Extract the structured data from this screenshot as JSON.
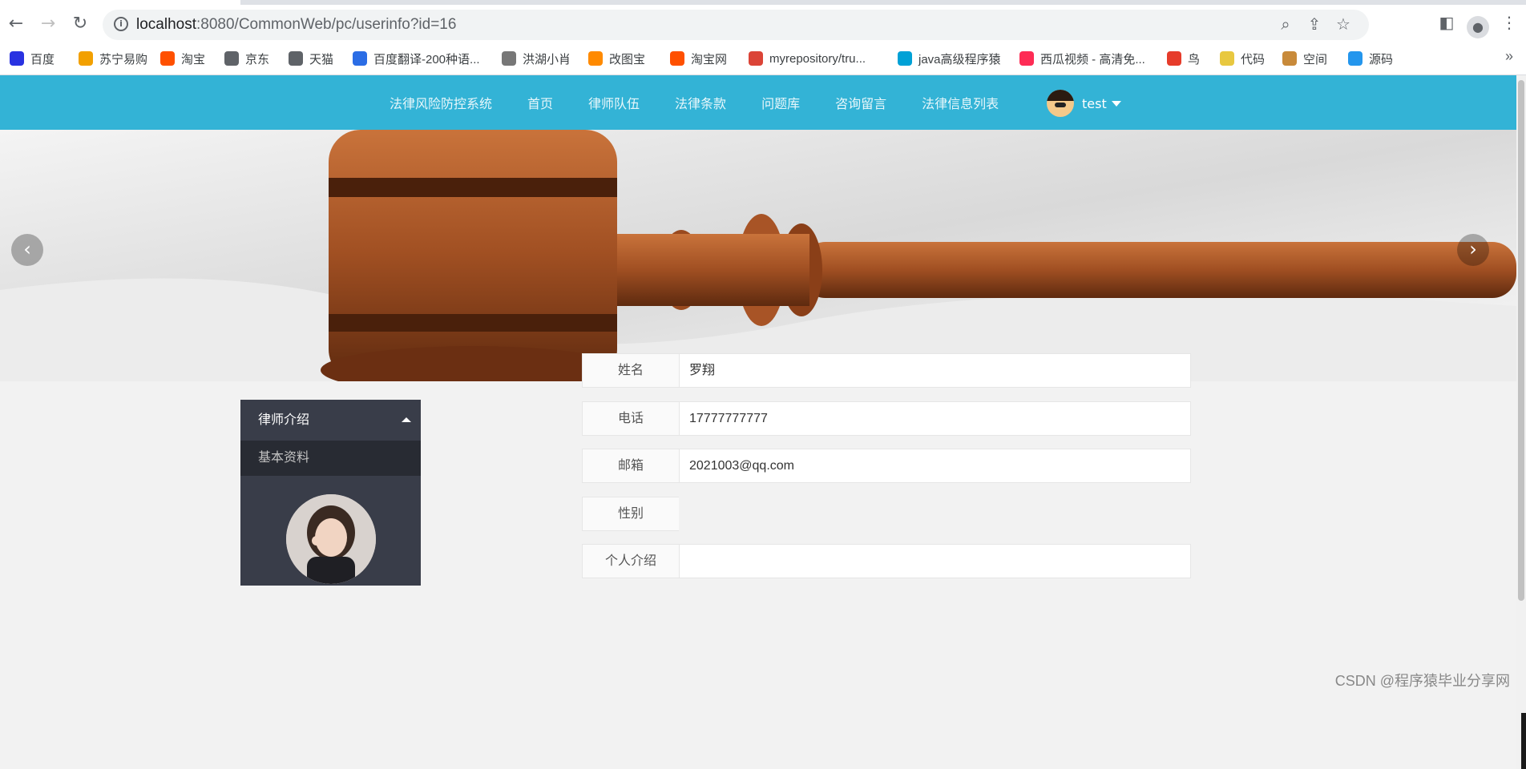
{
  "browser": {
    "url_host": "localhost",
    "url_rest": ":8080/CommonWeb/pc/userinfo?id=16",
    "bookmarks": [
      {
        "label": "百度",
        "icon": "baidu-icon",
        "color": "#2932e1"
      },
      {
        "label": "苏宁易购",
        "icon": "suning-icon",
        "color": "#f2a000"
      },
      {
        "label": "淘宝",
        "icon": "taobao-icon",
        "color": "#ff5000"
      },
      {
        "label": "京东",
        "icon": "globe-icon",
        "color": "#5f6368"
      },
      {
        "label": "天猫",
        "icon": "globe-icon",
        "color": "#5f6368"
      },
      {
        "label": "百度翻译-200种语...",
        "icon": "translate-icon",
        "color": "#2b6de5"
      },
      {
        "label": "洪湖小肖",
        "icon": "bird-icon",
        "color": "#777"
      },
      {
        "label": "改图宝",
        "icon": "gaitubao-icon",
        "color": "#ff8a00"
      },
      {
        "label": "淘宝网",
        "icon": "taobao-icon",
        "color": "#ff5000"
      },
      {
        "label": "myrepository/tru...",
        "icon": "chrome-icon",
        "color": "#db4437"
      },
      {
        "label": "java高级程序猿",
        "icon": "bilibili-icon",
        "color": "#00a1d6"
      },
      {
        "label": "西瓜视频 - 高清免...",
        "icon": "xigua-icon",
        "color": "#fe2c55"
      },
      {
        "label": "鸟",
        "icon": "bird-red-icon",
        "color": "#e63c2b"
      },
      {
        "label": "代码",
        "icon": "leaf-icon",
        "color": "#e8c840"
      },
      {
        "label": "空间",
        "icon": "dog-icon",
        "color": "#c88a3a"
      },
      {
        "label": "源码",
        "icon": "docker-icon",
        "color": "#2496ed"
      }
    ],
    "more": "»"
  },
  "nav": {
    "brand": "法律风险防控系统",
    "items": [
      "首页",
      "律师队伍",
      "法律条款",
      "问题库",
      "咨询留言",
      "法律信息列表"
    ],
    "user": "test"
  },
  "banner": {
    "prev": "‹",
    "next": "›",
    "slides": 4,
    "active_slide": 1
  },
  "sidebar": {
    "header": "律师介绍",
    "item": "基本资料"
  },
  "profile": {
    "rows": [
      {
        "label": "姓名",
        "value": "罗翔"
      },
      {
        "label": "电话",
        "value": "17777777777"
      },
      {
        "label": "邮箱",
        "value": "2021003@qq.com"
      },
      {
        "label": "性别",
        "value": ""
      },
      {
        "label": "个人介绍",
        "value": ""
      }
    ]
  },
  "watermark": "CSDN @程序猿毕业分享网",
  "colors": {
    "nav_bg": "#33b3d6",
    "sidebar_bg": "#393d49",
    "sidebar_item_bg": "#282b33"
  }
}
